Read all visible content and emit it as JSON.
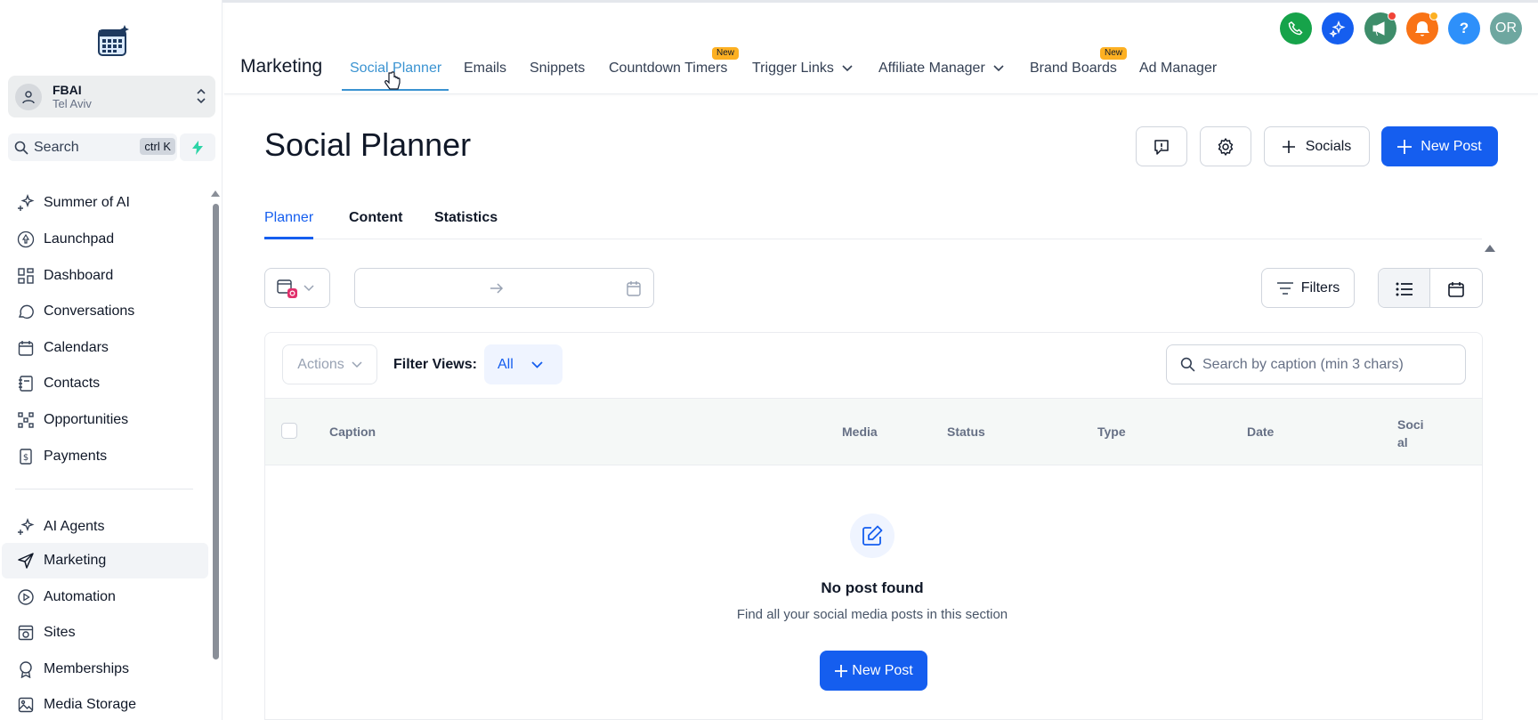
{
  "account": {
    "name": "FBAI",
    "location": "Tel Aviv"
  },
  "search": {
    "label": "Search",
    "shortcut": "ctrl K"
  },
  "sidebar": {
    "items": [
      {
        "label": "Summer of AI",
        "icon": "sparkles-icon"
      },
      {
        "label": "Launchpad",
        "icon": "rocket-icon"
      },
      {
        "label": "Dashboard",
        "icon": "grid-icon"
      },
      {
        "label": "Conversations",
        "icon": "chat-icon"
      },
      {
        "label": "Calendars",
        "icon": "calendar-icon"
      },
      {
        "label": "Contacts",
        "icon": "contact-book-icon"
      },
      {
        "label": "Opportunities",
        "icon": "pipeline-icon"
      },
      {
        "label": "Payments",
        "icon": "dollar-doc-icon"
      },
      {
        "label": "AI Agents",
        "icon": "sparkles-icon"
      },
      {
        "label": "Marketing",
        "icon": "send-icon",
        "active": true
      },
      {
        "label": "Automation",
        "icon": "automation-icon"
      },
      {
        "label": "Sites",
        "icon": "globe-icon"
      },
      {
        "label": "Memberships",
        "icon": "badge-icon"
      },
      {
        "label": "Media Storage",
        "icon": "image-icon"
      }
    ]
  },
  "topnav": {
    "module": "Marketing",
    "tabs": [
      {
        "label": "Social Planner",
        "active": true
      },
      {
        "label": "Emails"
      },
      {
        "label": "Snippets"
      },
      {
        "label": "Countdown Timers",
        "badge": "New"
      },
      {
        "label": "Trigger Links",
        "dropdown": true
      },
      {
        "label": "Affiliate Manager",
        "dropdown": true
      },
      {
        "label": "Brand Boards",
        "badge": "New"
      },
      {
        "label": "Ad Manager"
      }
    ]
  },
  "header_icons": {
    "phone_color": "#16a34a",
    "ai_color": "#155eef",
    "announce_color": "#3e8d6a",
    "bell_color": "#f97316",
    "help_color": "#2e90fa",
    "help_label": "?",
    "avatar_color": "#6ea7a0",
    "avatar_initials": "OR"
  },
  "page": {
    "title": "Social Planner",
    "socials_label": "Socials",
    "new_post_label": "New Post"
  },
  "tabs": {
    "planner": "Planner",
    "content": "Content",
    "statistics": "Statistics"
  },
  "filters": {
    "filters_label": "Filters"
  },
  "table": {
    "actions_label": "Actions",
    "filter_views_label": "Filter Views:",
    "filter_views_value": "All",
    "search_placeholder": "Search by caption (min 3 chars)",
    "columns": {
      "caption": "Caption",
      "media": "Media",
      "status": "Status",
      "type": "Type",
      "date": "Date",
      "social_1": "Soci",
      "social_2": "al"
    }
  },
  "empty": {
    "title": "No post found",
    "subtitle": "Find all your social media posts in this section",
    "button_label": "New Post"
  }
}
